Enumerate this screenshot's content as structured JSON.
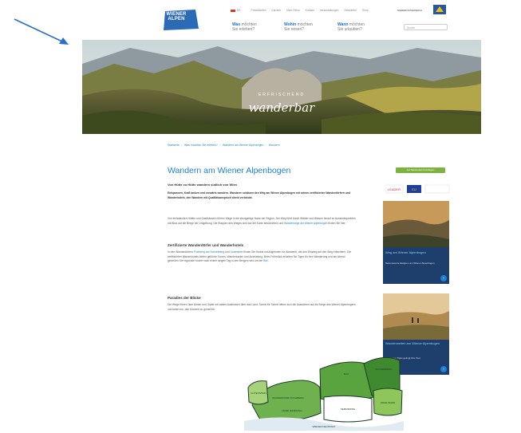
{
  "header": {
    "logo_text": "WIENER ALPEN",
    "top_links": [
      "DE",
      "Presseseiten",
      "Karriere",
      "Mein Reise",
      "Kontakt",
      "Veranstaltungen",
      "Newsletter",
      "Shop"
    ],
    "brand_text": "NIEDERÖSTERREICH",
    "nav": [
      {
        "strong": "Was",
        "rest": " möchten",
        "sub": "Sie erleben?"
      },
      {
        "strong": "Wohin",
        "rest": " möchten",
        "sub": "Sie reisen?"
      },
      {
        "strong": "Wann",
        "rest": " möchten",
        "sub": "Sie urlauben?"
      }
    ],
    "search_placeholder": "Suche"
  },
  "hero": {
    "kicker": "ERFRISCHEND",
    "title": "wanderbar"
  },
  "breadcrumb": [
    "Startseite",
    "Was möchten Sie erleben?",
    "Wandern am Wiener Alpenbogen",
    "Wandern"
  ],
  "article": {
    "title": "Wandern am Wiener Alpenbogen",
    "lead": "Von Hütte zu Hütte wandern südlich von Wien",
    "p1": "Entspannen, Kraft tanken und vorwärts wandern. Wanderer schätzen den Weg am Wiener Alpenbogen mit seinen zertifizierten Wanderdörfern und Wanderhotels, den Wandern mit Qualitätsanspruch direkt verbindet.",
    "p2a": "Von einladenden Hütten und Gasthäusern führen Wege in die einzigartige Natur der Region. Der Weg führt durch Wälder und Wiesen hinauf zu Aussichtspunkten mit Blick auf die Berge der Umgebung. Die Etappen des Weges sind auf der Karte beschrieben und ",
    "p2link": "Wanderwege am Wiener Alpenbogen",
    "p2b": " finden Sie hier.",
    "h2a": "Zertifizierte Wanderdörfer und Wanderhotels",
    "p3a": "In den Wanderdörfern ",
    "p3link1": "Puchberg am Schneeberg",
    "p3b": " und ",
    "p3link2": "Gutenstein",
    "p3c": " finden Sie Hotels mit Angeboten für Wanderer, die den Einstieg auf den Weg erleichtern. Die zertifizierten Wanderhotels bieten geführte Touren, Wanderkarten und Ausrüstung. Beim Frühstück erhalten Sie Tipps für Ihre Wanderung und am Abend genießen Sie regionale Küche nach einem langen Tag in den Bergen rund um die ",
    "p3link3": "Rax",
    "p3d": ".",
    "h2b": "Paradies der Blicke",
    "p4": "Die Wege führen über Almen und Gipfel mit weiten Ausblicken über das Land. Schritt für Schritt öffnen sich die Aussichten auf die Berge des Wiener Alpenbogens und laden ein, den Moment zu genießen."
  },
  "sidebar": {
    "share_label": "Auf Merkzettel hinzufügen",
    "partner_labels": [
      "LEADER",
      "EU"
    ],
    "cards": [
      {
        "title": "Weg am Wiener Alpenbogen",
        "text": "Sehenswerte Etappen am Wiener Alpenbogen"
      },
      {
        "title": "Wanderwelten am Wiener Alpenbogen",
        "text": "Mit diesen Tipps gelingt Ihre Tour"
      }
    ]
  },
  "map": {
    "labels": [
      "WANDERDORF PUCHBERG",
      "RAX",
      "SCHNEEBERG",
      "GUTENSTEIN",
      "HOHE WAND",
      "HOHE MANDLING",
      "SEMMERING",
      "WIENER NEUSTADT"
    ]
  },
  "colors": {
    "accent": "#1b7fd4",
    "nav_blue": "#1b6fc2",
    "card_bg": "#1e3f6b",
    "share_green": "#7bb33c",
    "arrow": "#2a6fc9"
  }
}
